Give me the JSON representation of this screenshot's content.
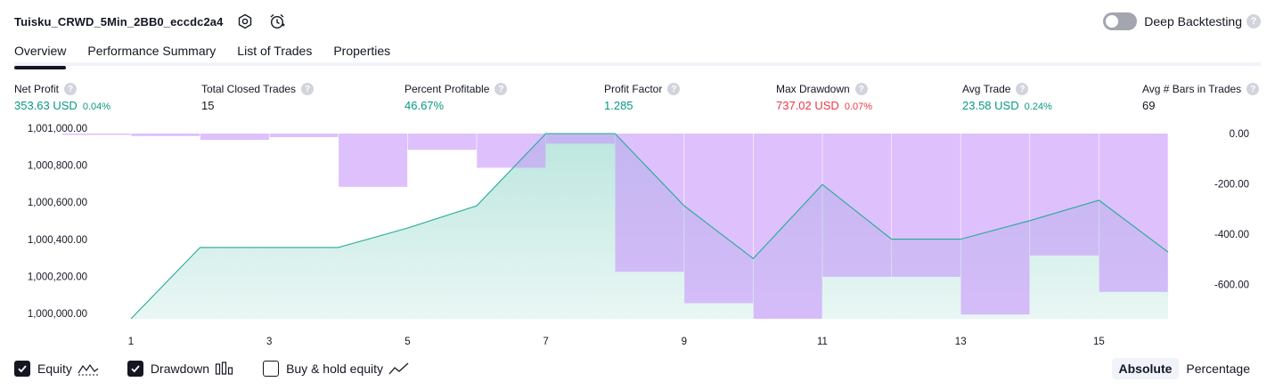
{
  "header": {
    "strategy_name": "Tuisku_CRWD_5Min_2BB0_eccdc2a4",
    "settings_icon": "gear-icon",
    "alert_icon": "alarm-clock-icon",
    "deep_backtesting_label": "Deep Backtesting",
    "deep_backtesting_enabled": false,
    "help_glyph": "?"
  },
  "tabs": [
    {
      "label": "Overview",
      "active": true
    },
    {
      "label": "Performance Summary",
      "active": false
    },
    {
      "label": "List of Trades",
      "active": false
    },
    {
      "label": "Properties",
      "active": false
    }
  ],
  "stats": [
    {
      "label": "Net Profit",
      "value": "353.63 USD",
      "pct": "0.04%",
      "color": "#089981"
    },
    {
      "label": "Total Closed Trades",
      "value": "15",
      "pct": "",
      "color": "#131722"
    },
    {
      "label": "Percent Profitable",
      "value": "46.67%",
      "pct": "",
      "color": "#089981"
    },
    {
      "label": "Profit Factor",
      "value": "1.285",
      "pct": "",
      "color": "#089981"
    },
    {
      "label": "Max Drawdown",
      "value": "737.02 USD",
      "pct": "0.07%",
      "color": "#f23645"
    },
    {
      "label": "Avg Trade",
      "value": "23.58 USD",
      "pct": "0.24%",
      "color": "#089981"
    },
    {
      "label": "Avg # Bars in Trades",
      "value": "69",
      "pct": "",
      "color": "#131722"
    }
  ],
  "chart_data": {
    "type": "area",
    "x_tick_labels": [
      "1",
      "3",
      "5",
      "7",
      "9",
      "11",
      "13",
      "15"
    ],
    "left_axis": {
      "tick_labels": [
        "1,001,000.00",
        "1,000,800.00",
        "1,000,600.00",
        "1,000,400.00",
        "1,000,200.00",
        "1,000,000.00"
      ],
      "ylim": [
        1000000,
        1001000
      ]
    },
    "right_axis": {
      "tick_labels": [
        "0.00",
        "-200.00",
        "-400.00",
        "-600.00"
      ],
      "ylim": [
        -737,
        0
      ]
    },
    "series": [
      {
        "name": "Equity",
        "x": [
          1,
          2,
          3,
          4,
          5,
          6,
          7,
          8,
          9,
          10,
          11,
          12,
          13,
          14,
          15,
          16
        ],
        "values": [
          1000000,
          1000385,
          1000385,
          1000385,
          1000490,
          1000610,
          1001000,
          1001000,
          1000610,
          1000325,
          1000725,
          1000430,
          1000430,
          1000530,
          1000640,
          1000360
        ],
        "color": "#22ab94"
      },
      {
        "name": "Drawdown",
        "x": [
          1,
          2,
          3,
          4,
          5,
          6,
          7,
          8,
          9,
          10,
          11,
          12,
          13,
          14,
          15,
          16
        ],
        "values": [
          -2,
          -10,
          -25,
          -14,
          -212,
          -65,
          -136,
          -40,
          -550,
          -675,
          -737,
          -570,
          -570,
          -720,
          -485,
          -630
        ],
        "color": "#c896fc"
      }
    ],
    "legend_placement": "bottom-left",
    "grid": false
  },
  "legend": [
    {
      "label": "Equity",
      "checked": true,
      "icon": "equity-line-icon"
    },
    {
      "label": "Drawdown",
      "checked": true,
      "icon": "drawdown-bars-icon"
    },
    {
      "label": "Buy & hold equity",
      "checked": false,
      "icon": "buy-hold-line-icon"
    }
  ],
  "display_mode": {
    "options": [
      "Absolute",
      "Percentage"
    ],
    "selected": "Absolute"
  }
}
